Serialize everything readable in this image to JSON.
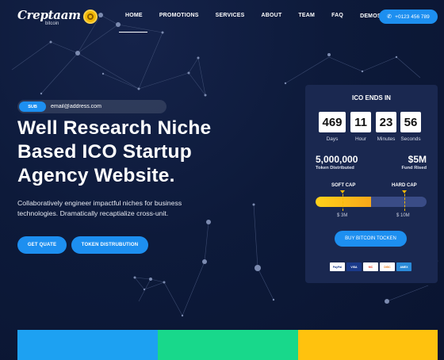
{
  "brand": {
    "name": "Creptaam",
    "sub": "bitcoin"
  },
  "nav": [
    {
      "label": "HOME"
    },
    {
      "label": "PROMOTIONS"
    },
    {
      "label": "SERVICES"
    },
    {
      "label": "ABOUT"
    },
    {
      "label": "TEAM"
    },
    {
      "label": "FAQ"
    },
    {
      "label": "DEMOS"
    }
  ],
  "nav_dropdown_glyph": "⌄",
  "phone": {
    "label": "+0123 456 789",
    "icon": "phone-icon"
  },
  "subscribe": {
    "button": "SUB",
    "value": "email@address.com"
  },
  "hero": {
    "title_lines": [
      "Well Research Niche",
      "Based ICO Startup",
      "Agency Website."
    ],
    "description": "Collaboratively engineer impactful niches for business technologies. Dramatically recaptialize cross-unit.",
    "button_primary": "GET QUATE",
    "button_secondary": "TOKEN DISTRUBUTION"
  },
  "ico": {
    "title": "ICO ENDS IN",
    "countdown": [
      {
        "value": "469",
        "label": "Days"
      },
      {
        "value": "11",
        "label": "Hour"
      },
      {
        "value": "23",
        "label": "Minutes"
      },
      {
        "value": "56",
        "label": "Seconds"
      }
    ],
    "tokens_value": "5,000,000",
    "tokens_label": "Token Distributed",
    "fund_value": "$5M",
    "fund_label": "Fund Rised",
    "soft_cap_label": "SOFT CAP",
    "hard_cap_label": "HARD CAP",
    "soft_cap_amount": "$ 3M",
    "hard_cap_amount": "$ 10M",
    "progress_fraction": 0.5,
    "buy_button": "BUY BITCOIN TOCKEN",
    "payments": [
      "PayPal",
      "VISA",
      "MC",
      "DISC",
      "AMEX"
    ]
  },
  "colors": {
    "accent": "#1d8ff0",
    "background": "#0d1a3a",
    "card": "#1a2850",
    "gold": "#f2b705",
    "strip_blue": "#1da1f2",
    "strip_green": "#18d88b",
    "strip_yellow": "#ffc20e"
  }
}
